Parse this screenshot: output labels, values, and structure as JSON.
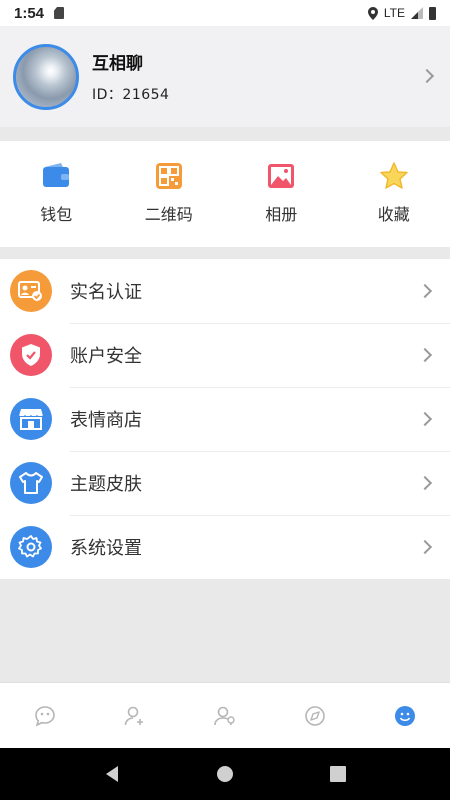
{
  "status_bar": {
    "time": "1:54",
    "network": "LTE"
  },
  "profile": {
    "name": "互相聊",
    "id_text": "ID：21654"
  },
  "quick_actions": [
    {
      "label": "钱包",
      "icon": "wallet-icon",
      "color": "#3d8be8"
    },
    {
      "label": "二维码",
      "icon": "qrcode-icon",
      "color": "#f59b3a"
    },
    {
      "label": "相册",
      "icon": "album-icon",
      "color": "#f0556a"
    },
    {
      "label": "收藏",
      "icon": "star-icon",
      "color": "#f5c23a"
    }
  ],
  "menu": [
    {
      "label": "实名认证",
      "icon": "id-card-icon",
      "color": "#f59b3a"
    },
    {
      "label": "账户安全",
      "icon": "shield-icon",
      "color": "#f0556a"
    },
    {
      "label": "表情商店",
      "icon": "store-icon",
      "color": "#3d8be8"
    },
    {
      "label": "主题皮肤",
      "icon": "shirt-icon",
      "color": "#3d8be8"
    },
    {
      "label": "系统设置",
      "icon": "gear-icon",
      "color": "#3d8be8"
    }
  ],
  "tabs": [
    {
      "icon": "chat-icon",
      "active": false
    },
    {
      "icon": "add-friend-icon",
      "active": false
    },
    {
      "icon": "contacts-icon",
      "active": false
    },
    {
      "icon": "discover-icon",
      "active": false
    },
    {
      "icon": "me-icon",
      "active": true
    }
  ],
  "colors": {
    "accent": "#3d8be8",
    "inactive_tab": "#b5b5b5"
  }
}
